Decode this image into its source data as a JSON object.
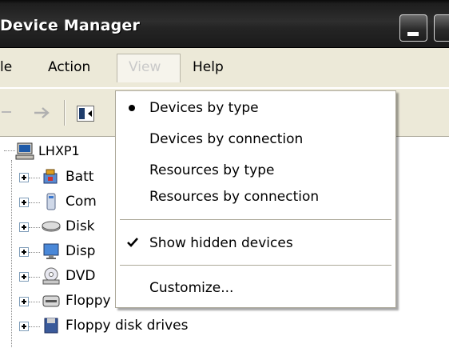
{
  "window": {
    "title": "Device Manager"
  },
  "menubar": {
    "file": "le",
    "action": "Action",
    "view": "View",
    "help": "Help"
  },
  "toolbar": {
    "back_icon": "back-arrow-icon",
    "forward_icon": "forward-arrow-icon",
    "panel_icon": "show-hide-console-tree-icon"
  },
  "tree": {
    "root": "LHXP1",
    "items": [
      {
        "label": "Batt",
        "icon": "battery-icon"
      },
      {
        "label": "Com",
        "icon": "computer-icon"
      },
      {
        "label": "Disk",
        "icon": "disk-drive-icon"
      },
      {
        "label": "Disp",
        "icon": "display-adapter-icon"
      },
      {
        "label": "DVD",
        "icon": "dvd-drive-icon"
      },
      {
        "label": "Floppy disk controllers",
        "icon": "floppy-controller-icon"
      },
      {
        "label": "Floppy disk drives",
        "icon": "floppy-drive-icon"
      }
    ]
  },
  "view_menu": {
    "items": [
      {
        "label": "Devices by type",
        "marker": "radio-bullet"
      },
      {
        "label": "Devices by connection"
      },
      {
        "label": "Resources by type"
      },
      {
        "label": "Resources by connection"
      },
      {
        "label": "Show hidden devices",
        "marker": "checkmark"
      },
      {
        "label": "Customize..."
      }
    ]
  }
}
